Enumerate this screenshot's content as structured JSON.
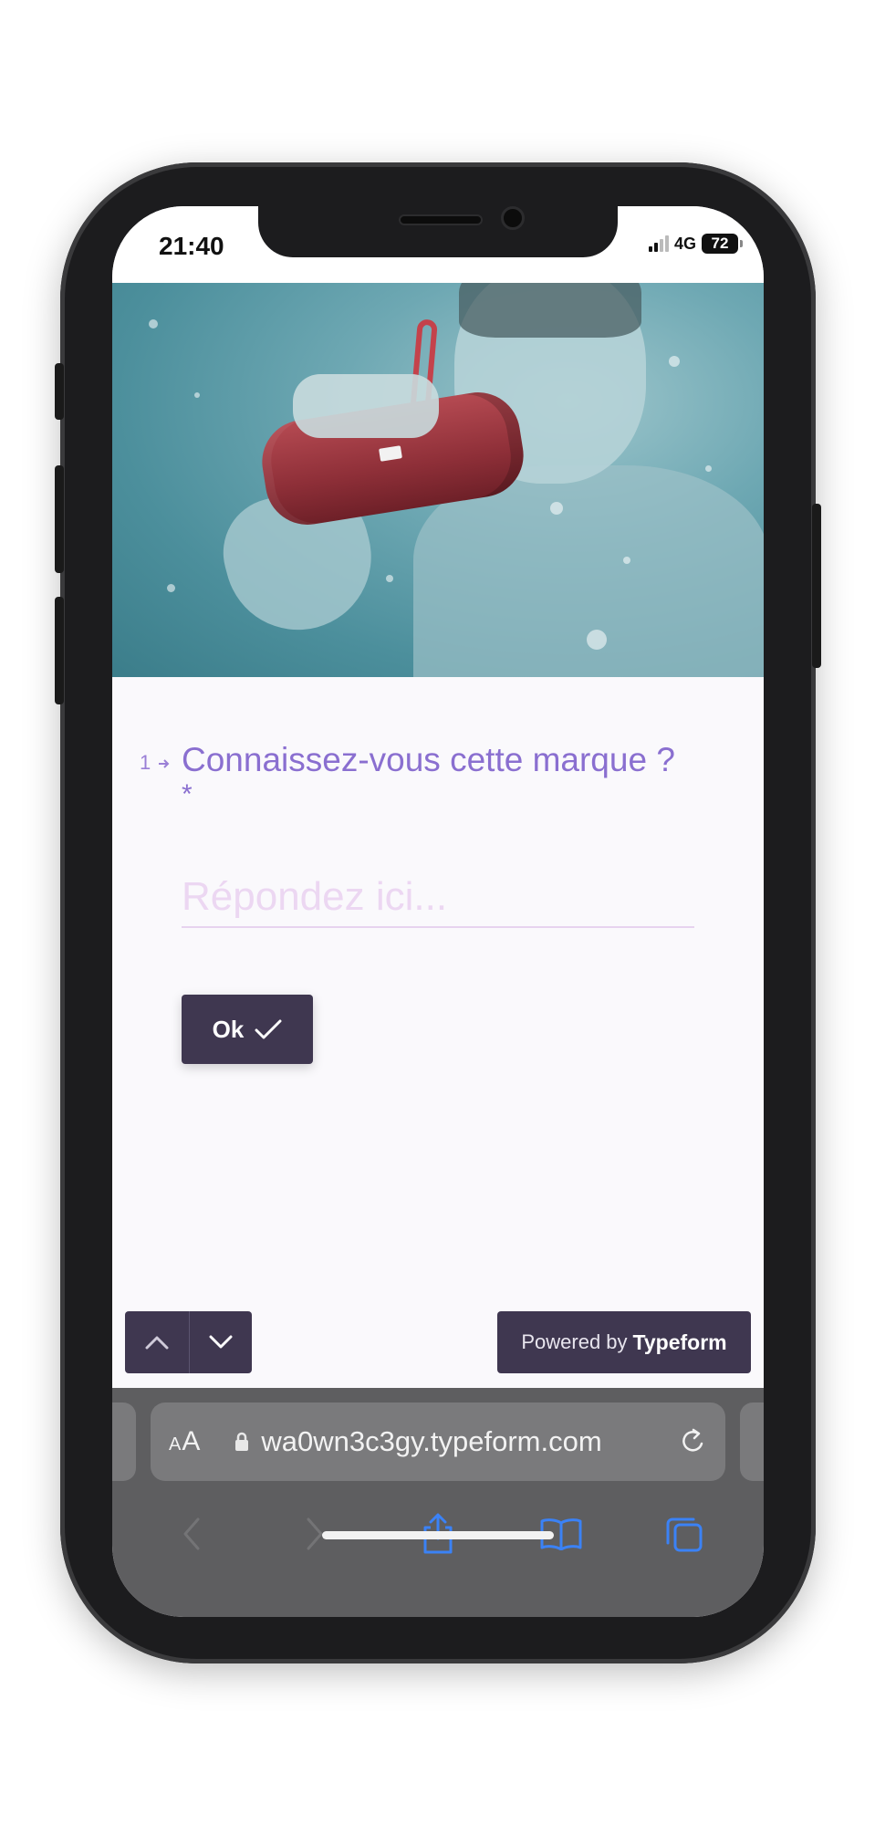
{
  "status_bar": {
    "time": "21:40",
    "network": "4G",
    "battery": "72"
  },
  "hero": {
    "description_icon": "jbl-speaker-underwater-photo"
  },
  "question": {
    "number": "1",
    "title": "Connaissez-vous cette marque ?",
    "required_mark": "*"
  },
  "answer": {
    "placeholder": "Répondez ici...",
    "value": ""
  },
  "ok_button": {
    "label": "Ok"
  },
  "footer": {
    "powered_prefix": "Powered by",
    "powered_brand": "Typeform"
  },
  "browser": {
    "aa_label_small": "A",
    "aa_label_large": "A",
    "url": "wa0wn3c3gy.typeform.com"
  },
  "colors": {
    "accent": "#8a6fd0",
    "button_bg": "#3f3750",
    "input_underline": "#e7d3ef"
  }
}
